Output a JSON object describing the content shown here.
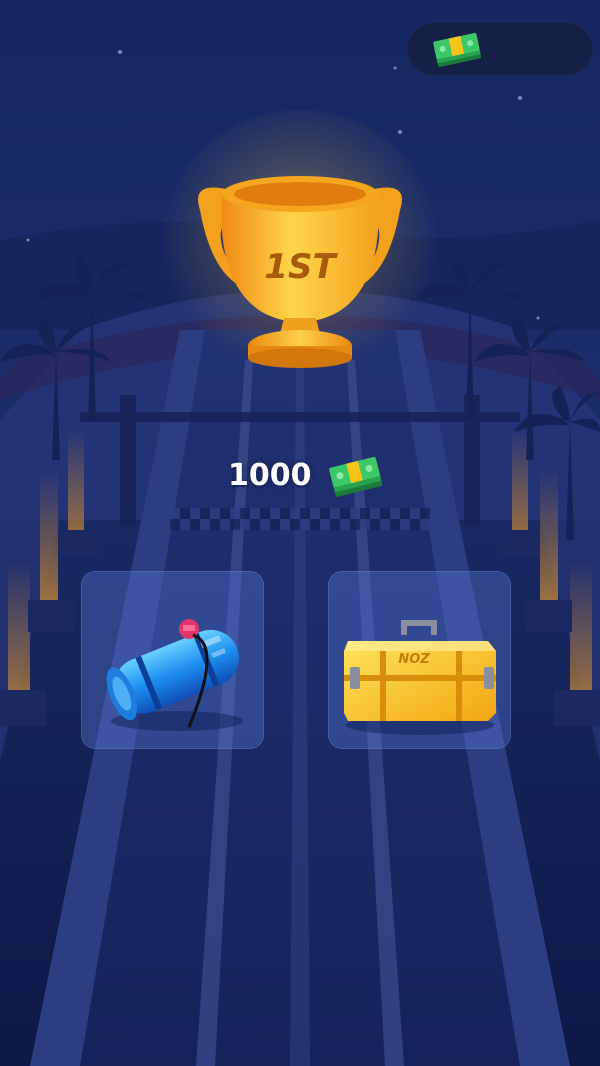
{
  "header": {
    "currency_icon": "cash-stack-icon",
    "currency_amount": ""
  },
  "trophy": {
    "icon": "gold-trophy-icon",
    "place_label": "1ST"
  },
  "reward": {
    "amount": "1000",
    "icon": "cash-stack-icon"
  },
  "items": [
    {
      "name": "nitro-tank",
      "icon": "blue-nitro-tank-icon"
    },
    {
      "name": "loot-box",
      "icon": "yellow-crate-icon",
      "label": "NOZ"
    }
  ],
  "colors": {
    "night_sky": "#0f1e4a",
    "trophy_gold": "#f5b419",
    "cash_green": "#2fb35a",
    "card_fill": "#5a82dc"
  }
}
